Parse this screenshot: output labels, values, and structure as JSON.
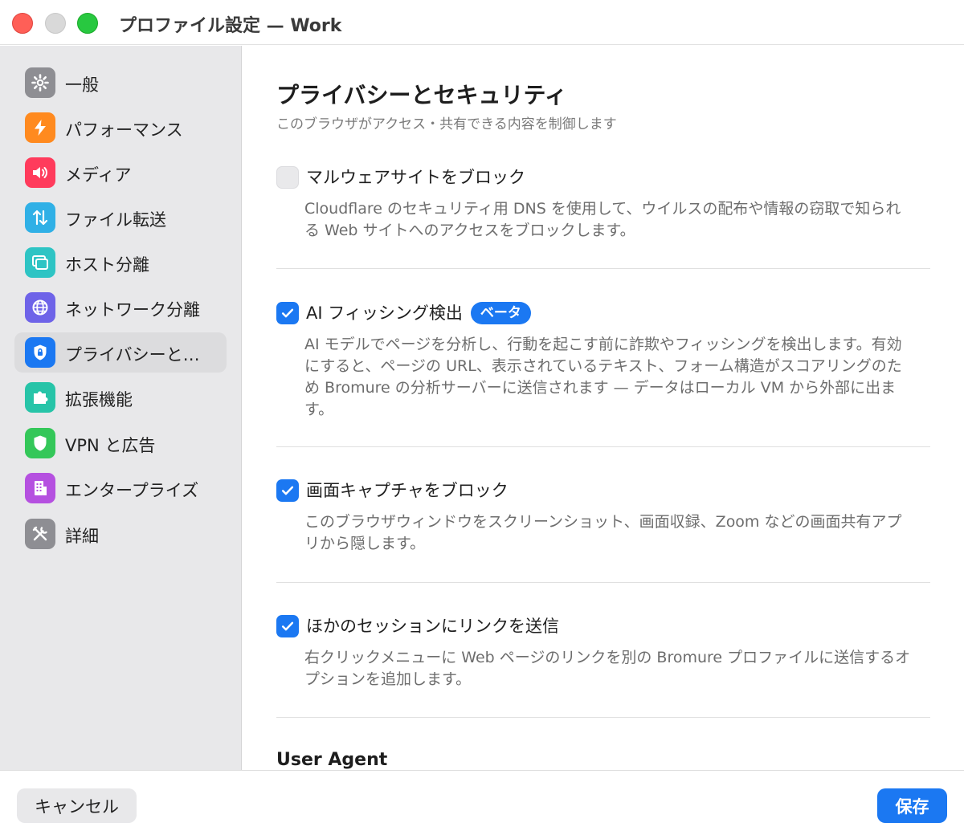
{
  "window": {
    "title": "プロファイル設定 — Work"
  },
  "sidebar": {
    "items": [
      {
        "label": "一般",
        "icon": "gear-icon",
        "color": "#8e8e93"
      },
      {
        "label": "パフォーマンス",
        "icon": "bolt-icon",
        "color": "#ff8a1f"
      },
      {
        "label": "メディア",
        "icon": "speaker-icon",
        "color": "#ff3b5c"
      },
      {
        "label": "ファイル転送",
        "icon": "arrows-updown-icon",
        "color": "#30b0e6"
      },
      {
        "label": "ホスト分離",
        "icon": "windows-icon",
        "color": "#2ec4c4"
      },
      {
        "label": "ネットワーク分離",
        "icon": "globe-icon",
        "color": "#6e63e8"
      },
      {
        "label": "プライバシーと…",
        "icon": "lock-shield-icon",
        "color": "#1b78f2"
      },
      {
        "label": "拡張機能",
        "icon": "puzzle-icon",
        "color": "#27c4a8"
      },
      {
        "label": "VPN と広告",
        "icon": "shield-icon",
        "color": "#34c759"
      },
      {
        "label": "エンタープライズ",
        "icon": "building-icon",
        "color": "#b550e0"
      },
      {
        "label": "詳細",
        "icon": "tools-icon",
        "color": "#8e8e93"
      }
    ]
  },
  "main": {
    "title": "プライバシーとセキュリティ",
    "subtitle": "このブラウザがアクセス・共有できる内容を制御します",
    "options": [
      {
        "title": "マルウェアサイトをブロック",
        "checked": false,
        "description": "Cloudflare のセキュリティ用 DNS を使用して、ウイルスの配布や情報の窃取で知られる Web サイトへのアクセスをブロックします。"
      },
      {
        "title": "AI フィッシング検出",
        "badge": "ベータ",
        "checked": true,
        "description": "AI モデルでページを分析し、行動を起こす前に詐欺やフィッシングを検出します。有効にすると、ページの URL、表示されているテキスト、フォーム構造がスコアリングのため Bromure の分析サーバーに送信されます — データはローカル VM から外部に出ます。"
      },
      {
        "title": "画面キャプチャをブロック",
        "checked": true,
        "description": "このブラウザウィンドウをスクリーンショット、画面収録、Zoom などの画面共有アプリから隠します。"
      },
      {
        "title": "ほかのセッションにリンクを送信",
        "checked": true,
        "description": "右クリックメニューに Web ページのリンクを別の Bromure プロファイルに送信するオプションを追加します。"
      }
    ],
    "next_section": "User Agent"
  },
  "footer": {
    "cancel_label": "キャンセル",
    "save_label": "保存"
  },
  "colors": {
    "accent": "#1b78f2",
    "sidebar_bg": "#e8e8ea"
  }
}
